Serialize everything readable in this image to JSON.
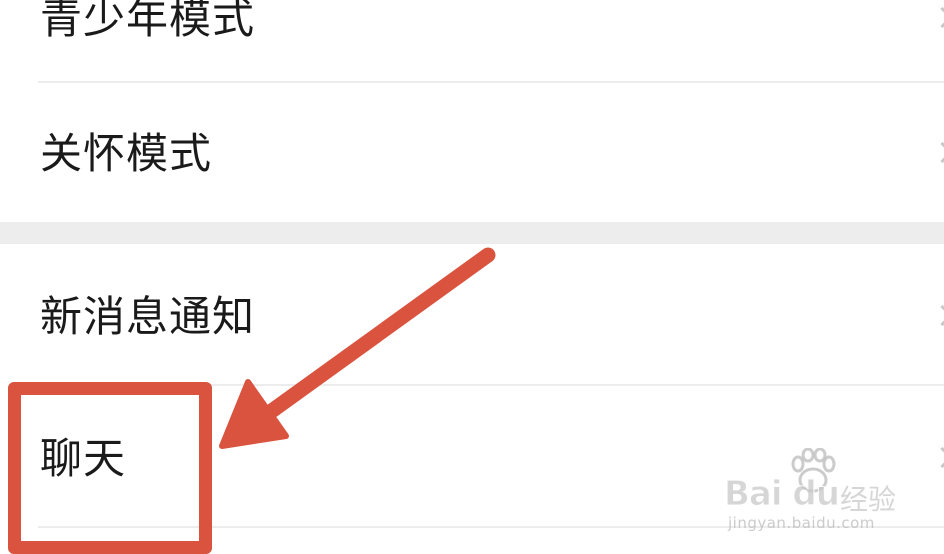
{
  "settings": {
    "items": [
      {
        "label": "青少年模式"
      },
      {
        "label": "关怀模式"
      },
      {
        "label": "新消息通知"
      },
      {
        "label": "聊天"
      }
    ]
  },
  "annotation": {
    "highlight_color": "#d9533f",
    "arrow_color": "#d9533f",
    "highlighted_item": "聊天"
  },
  "watermark": {
    "brand": "Bai  du",
    "suffix": "经验",
    "url": "jingyan.baidu.com",
    "icon": "paw-icon"
  },
  "colors": {
    "background": "#ffffff",
    "section_gap": "#ededed",
    "divider": "#ececec",
    "text": "#1a1a1a"
  }
}
